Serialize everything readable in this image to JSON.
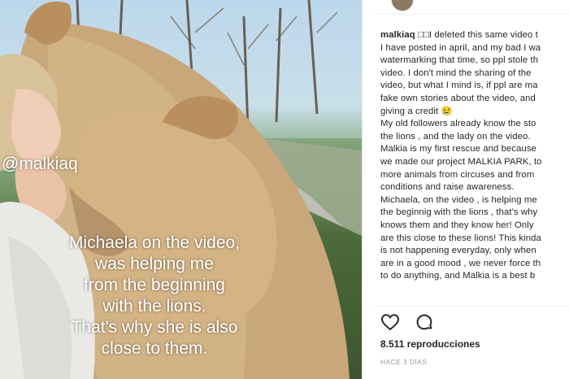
{
  "video": {
    "watermark": "@malkiaq",
    "caption": "Michaela on the video,\nwas helping me\nfrom the beginning\nwith the lions.\nThat's why she is also\nclose to them."
  },
  "post": {
    "username": "malkiaq",
    "lines": [
      "□□I deleted this same video t",
      "I have posted in april, and my bad I wa",
      "watermarking that time, so ppl stole th",
      "video. I don't mind the sharing of the",
      "video, but what I mind is, if ppl are ma",
      "fake own stories about the video, and",
      "giving a credit 😢",
      "My old followers already know the sto",
      "the lions , and the lady on the video.",
      "Malkia is my first rescue and because",
      "we made our project MALKIA PARK, to",
      "more animals from circuses and from",
      "conditions and raise awareness.",
      "Michaela, on the video , is helping me",
      "the beginnig with the lions , that's why",
      "knows them and they know her! Only",
      "are this close to these lions! This kinda",
      "is not happening everyday, only when",
      "are in a good mood , we never force th",
      "to do anything, and Malkia is a best b"
    ],
    "actions": {
      "like_icon": "heart-outline",
      "comment_icon": "speech-bubble"
    },
    "views": "8.511 reproducciones",
    "time": "HACE 3 DÍAS"
  }
}
